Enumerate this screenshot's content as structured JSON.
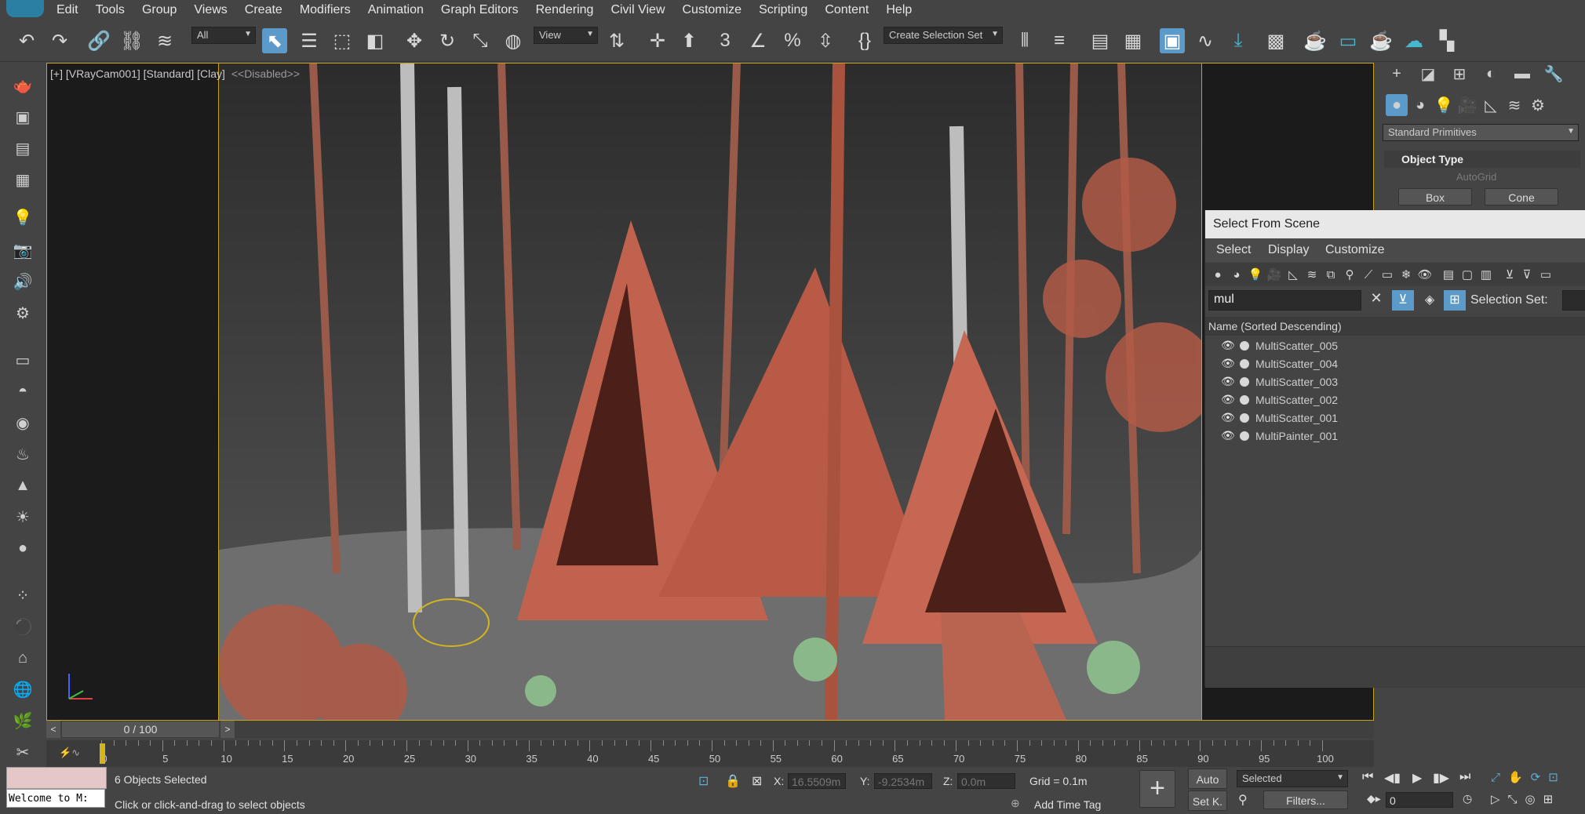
{
  "menu": [
    "Edit",
    "Tools",
    "Group",
    "Views",
    "Create",
    "Modifiers",
    "Animation",
    "Graph Editors",
    "Rendering",
    "Civil View",
    "Customize",
    "Scripting",
    "Content",
    "Help"
  ],
  "toolbar": {
    "filter_select": "All",
    "ref_coord": "View",
    "selection_set": "Create Selection Set"
  },
  "viewport": {
    "label": "[+] [VRayCam001] [Standard] [Clay]",
    "disabled": "<<Disabled>>"
  },
  "command_panel": {
    "category": "Standard Primitives",
    "rollout": "Object Type",
    "autogrid": "AutoGrid",
    "buttons": [
      "Box",
      "Cone"
    ]
  },
  "dialog": {
    "title": "Select From Scene",
    "menu": [
      "Select",
      "Display",
      "Customize"
    ],
    "search_value": "mul",
    "selection_set_label": "Selection Set:",
    "column_header": "Name (Sorted Descending)",
    "items": [
      "MultiScatter_005",
      "MultiScatter_004",
      "MultiScatter_003",
      "MultiScatter_002",
      "MultiScatter_001",
      "MultiPainter_001"
    ]
  },
  "timeline": {
    "frame": "0 / 100",
    "ticks": [
      "0",
      "5",
      "10",
      "15",
      "20",
      "25",
      "30",
      "35",
      "40",
      "45",
      "50",
      "55",
      "60",
      "65",
      "70",
      "75",
      "80",
      "85",
      "90",
      "95",
      "100"
    ]
  },
  "status": {
    "maxscript": "Welcome to M:",
    "selected": "6 Objects Selected",
    "prompt": "Click or click-and-drag to select objects",
    "x_label": "X:",
    "x": "16.5509m",
    "y_label": "Y:",
    "y": "-9.2534m",
    "z_label": "Z:",
    "z": "0.0m",
    "grid": "Grid = 0.1m",
    "add_time_tag": "Add Time Tag",
    "auto": "Auto",
    "set_key": "Set K.",
    "key_mode": "Selected",
    "filters": "Filters...",
    "current_frame": "0"
  }
}
